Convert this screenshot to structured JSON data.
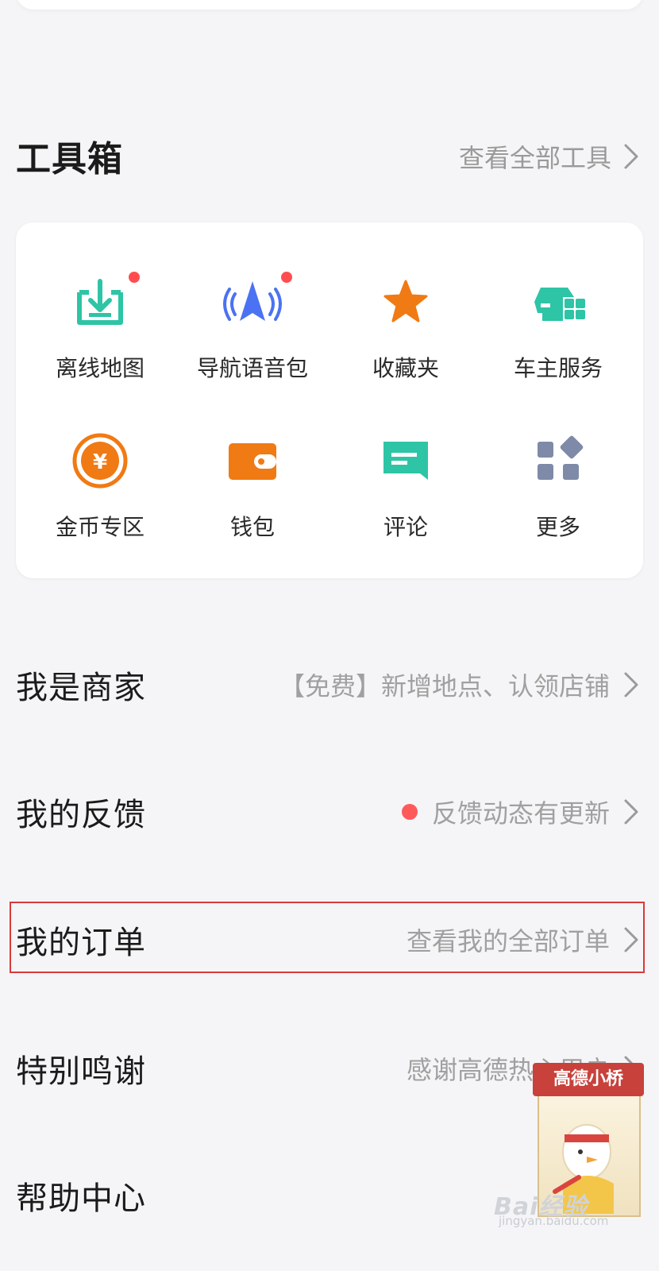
{
  "toolbox": {
    "title": "工具箱",
    "view_all": "查看全部工具",
    "tools": [
      {
        "label": "离线地图",
        "icon": "offline-map-download-icon",
        "has_dot": true
      },
      {
        "label": "导航语音包",
        "icon": "navigation-voice-icon",
        "has_dot": true
      },
      {
        "label": "收藏夹",
        "icon": "star-icon",
        "has_dot": false
      },
      {
        "label": "车主服务",
        "icon": "car-service-icon",
        "has_dot": false
      },
      {
        "label": "金币专区",
        "icon": "gold-coin-icon",
        "has_dot": false
      },
      {
        "label": "钱包",
        "icon": "wallet-icon",
        "has_dot": false
      },
      {
        "label": "评论",
        "icon": "comment-icon",
        "has_dot": false
      },
      {
        "label": "更多",
        "icon": "more-grid-icon",
        "has_dot": false
      }
    ]
  },
  "menu": [
    {
      "title": "我是商家",
      "subtitle": "【免费】新增地点、认领店铺"
    },
    {
      "title": "我的反馈",
      "subtitle": "反馈动态有更新",
      "has_dot": true
    },
    {
      "title": "我的订单",
      "subtitle": "查看我的全部订单",
      "highlighted": true
    },
    {
      "title": "特别鸣谢",
      "subtitle": "感谢高德热心用户"
    },
    {
      "title": "帮助中心",
      "subtitle": ""
    }
  ],
  "mascot": {
    "banner": "高德小桥"
  },
  "watermark": {
    "logo": "Bai经验",
    "url": "jingyan.baidu.com"
  },
  "colors": {
    "teal": "#2ec4a6",
    "blue": "#4b72f2",
    "orange": "#f07a14",
    "red_dot": "#ff4d4f",
    "highlight": "#d93a3a"
  }
}
